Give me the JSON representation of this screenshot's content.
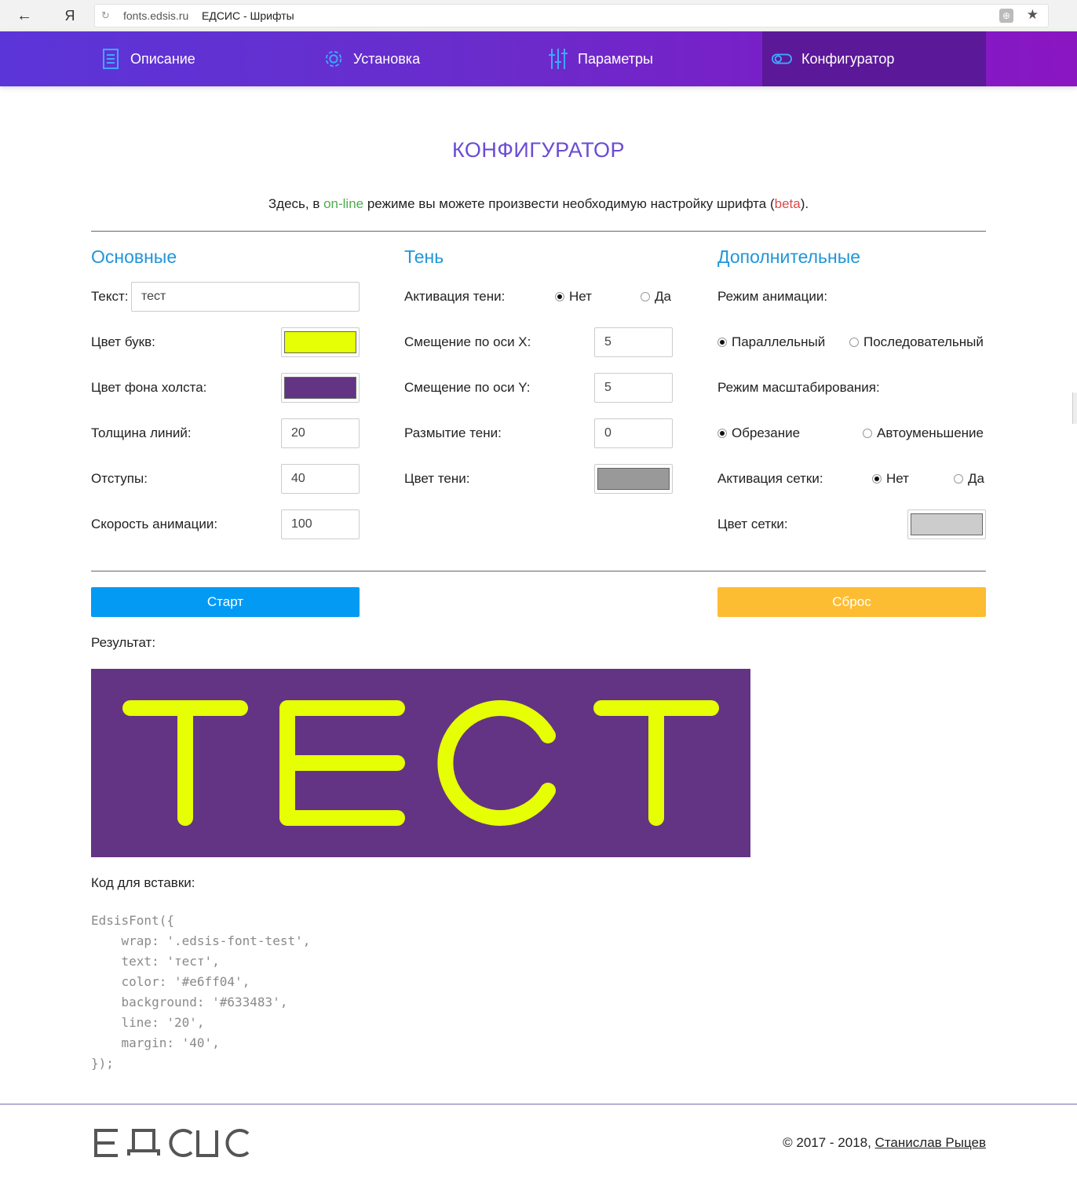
{
  "browser": {
    "back": "←",
    "ya": "Я",
    "reload": "↻",
    "url": "fonts.edsis.ru",
    "tab_title": "ЕДСИС - Шрифты",
    "star": "★"
  },
  "nav": {
    "items": [
      {
        "label": "Описание",
        "icon": "document-icon"
      },
      {
        "label": "Установка",
        "icon": "gear-icon"
      },
      {
        "label": "Параметры",
        "icon": "sliders-icon"
      },
      {
        "label": "Конфигуратор",
        "icon": "toggle-icon",
        "active": true
      }
    ]
  },
  "page": {
    "title": "КОНФИГУРАТОР",
    "intro_before": "Здесь, в ",
    "intro_online": "on-line",
    "intro_middle": " режиме вы можете произвести необходимую настройку шрифта (",
    "intro_beta": "beta",
    "intro_after": ")."
  },
  "basic": {
    "title": "Основные",
    "text_label": "Текст:",
    "text_value": "тест",
    "letter_color_label": "Цвет букв:",
    "letter_color": "#e6ff04",
    "bg_color_label": "Цвет фона холста:",
    "bg_color": "#633483",
    "line_label": "Толщина линий:",
    "line_value": "20",
    "margin_label": "Отступы:",
    "margin_value": "40",
    "speed_label": "Скорость анимации:",
    "speed_value": "100"
  },
  "shadow": {
    "title": "Тень",
    "activate_label": "Активация тени:",
    "no": "Нет",
    "yes": "Да",
    "offset_x_label": "Смещение по оси X:",
    "offset_x": "5",
    "offset_y_label": "Смещение по оси Y:",
    "offset_y": "5",
    "blur_label": "Размытие тени:",
    "blur": "0",
    "color_label": "Цвет тени:",
    "color": "#999999"
  },
  "extra": {
    "title": "Дополнительные",
    "anim_mode_label": "Режим анимации:",
    "parallel": "Параллельный",
    "sequential": "Последовательный",
    "scale_mode_label": "Режим масштабирования:",
    "crop": "Обрезание",
    "auto_shrink": "Автоуменьшение",
    "grid_label": "Активация сетки:",
    "no": "Нет",
    "yes": "Да",
    "grid_color_label": "Цвет сетки:",
    "grid_color": "#cccccc"
  },
  "actions": {
    "start": "Старт",
    "reset": "Сброс"
  },
  "result": {
    "label": "Результат:",
    "preview_text": "ТЕСТ"
  },
  "code": {
    "label": "Код для вставки:",
    "snippet": "EdsisFont({\n    wrap: '.edsis-font-test',\n    text: 'тест',\n    color: '#e6ff04',\n    background: '#633483',\n    line: '20',\n    margin: '40',\n});"
  },
  "footer": {
    "logo": "ЕДСИС",
    "copyright": "© 2017 - 2018, ",
    "author": "Станислав Рыцев"
  }
}
